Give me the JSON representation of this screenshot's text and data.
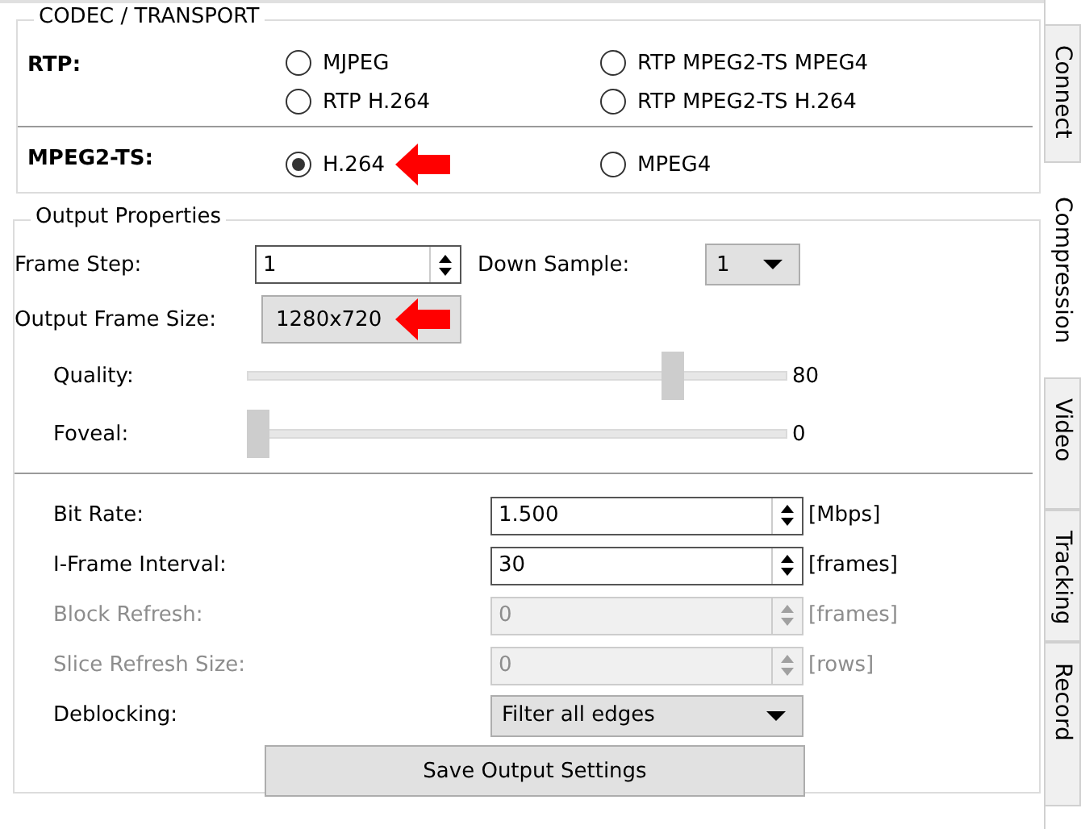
{
  "codec": {
    "title": "CODEC / TRANSPORT",
    "rows": [
      {
        "label": "RTP:",
        "options": [
          {
            "label": "MJPEG",
            "selected": false
          },
          {
            "label": "RTP MPEG2-TS MPEG4",
            "selected": false
          },
          {
            "label": "RTP H.264",
            "selected": false
          },
          {
            "label": "RTP MPEG2-TS H.264",
            "selected": false
          }
        ]
      },
      {
        "label": "MPEG2-TS:",
        "options": [
          {
            "label": "H.264",
            "selected": true,
            "annotated": true
          },
          {
            "label": "MPEG4",
            "selected": false
          }
        ]
      }
    ]
  },
  "output": {
    "title": "Output Properties",
    "frame_step": {
      "label": "Frame Step:",
      "value": "1"
    },
    "down_sample": {
      "label": "Down Sample:",
      "value": "1"
    },
    "frame_size": {
      "label": "Output Frame Size:",
      "value": "1280x720",
      "annotated": true
    },
    "sliders": [
      {
        "label": "Quality:",
        "level": 0.8,
        "reading": "80"
      },
      {
        "label": "Foveal:",
        "level": 0,
        "reading": "0"
      }
    ],
    "params": [
      {
        "label": "Bit Rate:",
        "value": "1.500",
        "unit": "[Mbps]",
        "disabled": false
      },
      {
        "label": "I-Frame Interval:",
        "value": "30",
        "unit": "[frames]",
        "disabled": false
      },
      {
        "label": "Block Refresh:",
        "value": "0",
        "unit": "[frames]",
        "disabled": true
      },
      {
        "label": "Slice Refresh Size:",
        "value": "0",
        "unit": "[rows]",
        "disabled": true
      }
    ],
    "deblocking": {
      "label": "Deblocking:",
      "value": "Filter all edges"
    },
    "save_button": "Save Output Settings"
  },
  "tabs": [
    {
      "label": "Connect",
      "selected": false
    },
    {
      "label": "Compression",
      "selected": true
    },
    {
      "label": "Video",
      "selected": false
    },
    {
      "label": "Tracking",
      "selected": false
    },
    {
      "label": "Record",
      "selected": false
    }
  ]
}
